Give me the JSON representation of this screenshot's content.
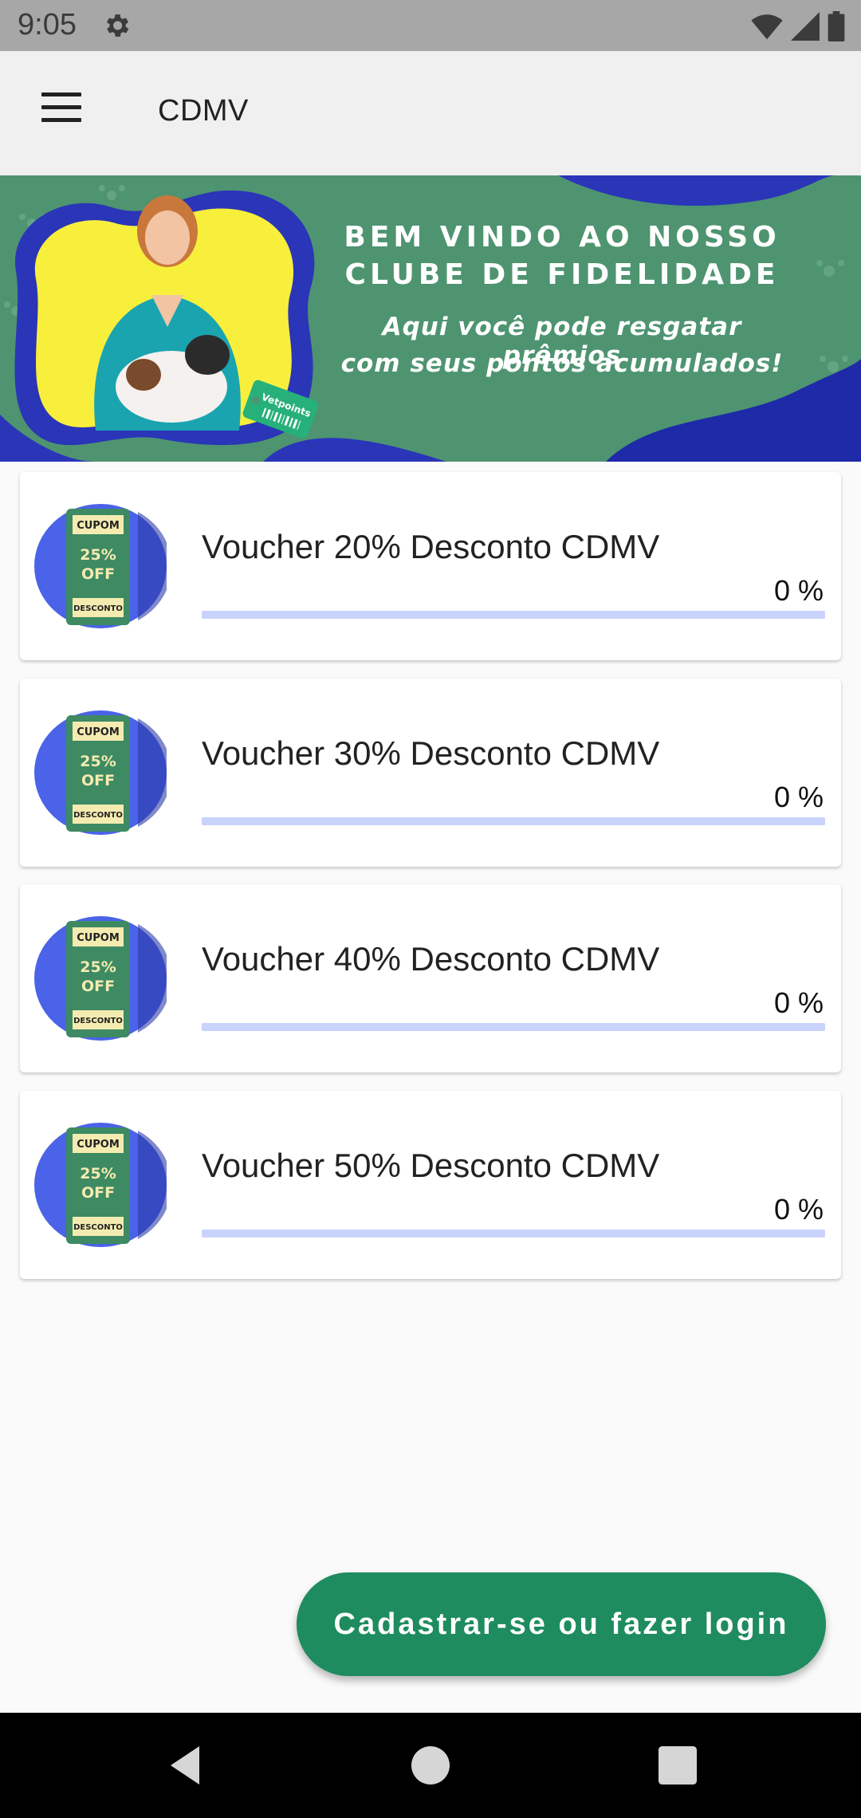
{
  "status_bar": {
    "time": "9:05",
    "icons": [
      "settings-icon",
      "wifi-icon",
      "signal-icon",
      "battery-icon"
    ]
  },
  "app_bar": {
    "title": "CDMV",
    "menu_icon": "hamburger-menu-icon"
  },
  "banner": {
    "line1": "BEM VINDO AO NOSSO",
    "line2": "CLUBE DE FIDELIDADE",
    "line3": "Aqui você pode resgatar prêmios",
    "line4": "com seus pontos acumulados!",
    "tag_text": "Vetpoints"
  },
  "vouchers": [
    {
      "title": "Voucher 20% Desconto CDMV",
      "progress_text": "0 %",
      "progress": 0,
      "thumb": {
        "top": "CUPOM",
        "pct": "25%",
        "off": "OFF",
        "bottom": "DESCONTO"
      }
    },
    {
      "title": "Voucher 30% Desconto CDMV",
      "progress_text": "0 %",
      "progress": 0,
      "thumb": {
        "top": "CUPOM",
        "pct": "25%",
        "off": "OFF",
        "bottom": "DESCONTO"
      }
    },
    {
      "title": "Voucher 40% Desconto CDMV",
      "progress_text": "0 %",
      "progress": 0,
      "thumb": {
        "top": "CUPOM",
        "pct": "25%",
        "off": "OFF",
        "bottom": "DESCONTO"
      }
    },
    {
      "title": "Voucher 50% Desconto CDMV",
      "progress_text": "0 %",
      "progress": 0,
      "thumb": {
        "top": "CUPOM",
        "pct": "25%",
        "off": "OFF",
        "bottom": "DESCONTO"
      }
    }
  ],
  "fab": {
    "label": "Cadastrar-se ou fazer login"
  },
  "nav_bar": {
    "icons": [
      "back-icon",
      "home-icon",
      "recents-icon"
    ]
  },
  "colors": {
    "banner_green": "#4e9470",
    "banner_blue": "#2a35b8",
    "banner_yellow": "#f8ef3c",
    "fab_green": "#1e8c5e",
    "progress_track": "#c9d3fb"
  }
}
